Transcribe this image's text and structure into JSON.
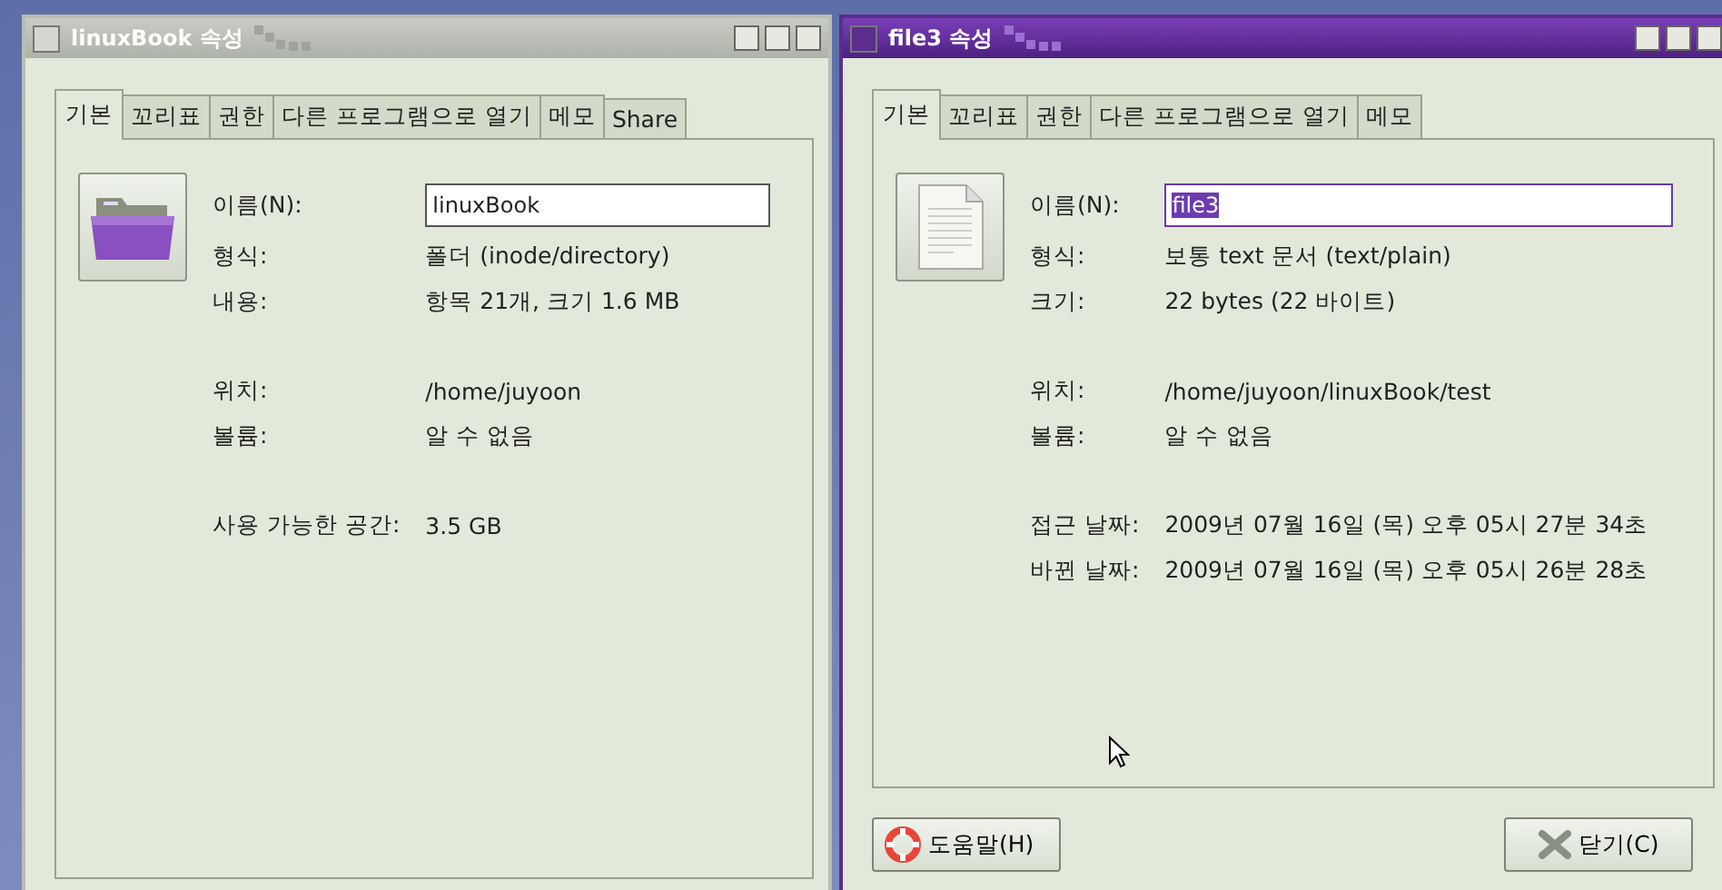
{
  "windows": [
    {
      "title": "linuxBook 속성",
      "active": false,
      "icon": {
        "kind": "folder"
      },
      "tabs": [
        {
          "label": "기본",
          "selected": true
        },
        {
          "label": "꼬리표",
          "selected": false
        },
        {
          "label": "권한",
          "selected": false
        },
        {
          "label": "다른 프로그램으로 열기",
          "selected": false
        },
        {
          "label": "메모",
          "selected": false
        },
        {
          "label": "Share",
          "selected": false
        }
      ],
      "name_field": {
        "label": "이름(N):",
        "value": "linuxBook",
        "selected": false
      },
      "sections": [
        [
          {
            "label": "형식:",
            "value": "폴더 (inode/directory)"
          },
          {
            "label": "내용:",
            "value": "항목 21개, 크기 1.6 MB"
          }
        ],
        [
          {
            "label": "위치:",
            "value": "/home/juyoon"
          },
          {
            "label": "볼륨:",
            "value": "알 수 없음"
          }
        ],
        [
          {
            "label": "사용 가능한 공간:",
            "value": "3.5 GB"
          }
        ]
      ]
    },
    {
      "title": "file3 속성",
      "active": true,
      "icon": {
        "kind": "document"
      },
      "tabs": [
        {
          "label": "기본",
          "selected": true
        },
        {
          "label": "꼬리표",
          "selected": false
        },
        {
          "label": "권한",
          "selected": false
        },
        {
          "label": "다른 프로그램으로 열기",
          "selected": false
        },
        {
          "label": "메모",
          "selected": false
        }
      ],
      "name_field": {
        "label": "이름(N):",
        "value": "file3",
        "selected": true
      },
      "sections": [
        [
          {
            "label": "형식:",
            "value": "보통 text 문서 (text/plain)"
          },
          {
            "label": "크기:",
            "value": "22 bytes (22 바이트)"
          }
        ],
        [
          {
            "label": "위치:",
            "value": "/home/juyoon/linuxBook/test"
          },
          {
            "label": "볼륨:",
            "value": "알 수 없음"
          }
        ],
        [
          {
            "label": "접근 날짜:",
            "value": "2009년 07월 16일 (목) 오후 05시 27분 34초"
          },
          {
            "label": "바뀐 날짜:",
            "value": "2009년 07월 16일 (목) 오후 05시 26분 28초"
          }
        ]
      ],
      "buttons": [
        {
          "label": "도움말(H)",
          "kind": "help"
        },
        {
          "label": "닫기(C)",
          "kind": "close"
        }
      ]
    }
  ]
}
